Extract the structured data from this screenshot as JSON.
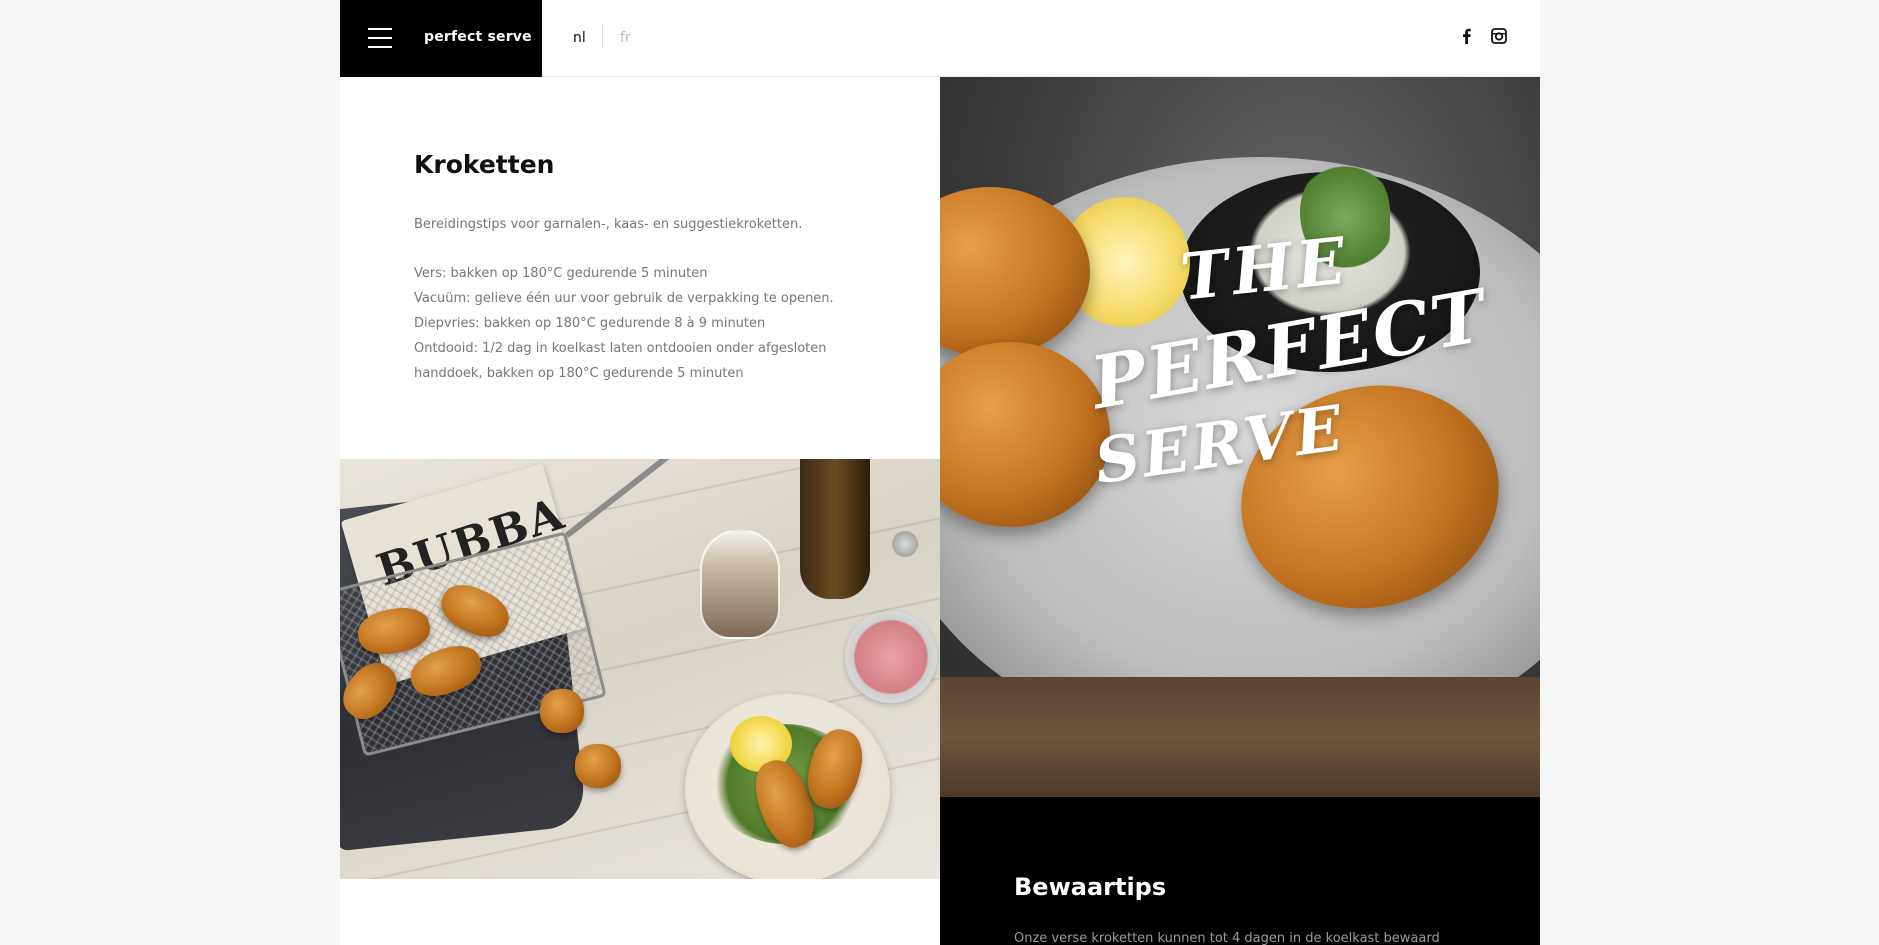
{
  "header": {
    "brand": "perfect serve",
    "languages": [
      {
        "code": "nl",
        "active": true
      },
      {
        "code": "fr",
        "active": false
      }
    ],
    "social": [
      "facebook-icon",
      "instagram-icon"
    ]
  },
  "intro": {
    "title": "Kroketten",
    "lead": "Bereidingstips voor garnalen-, kaas- en suggestiekroketten.",
    "tips": [
      "Vers: bakken op 180°C gedurende 5 minuten",
      "Vacuüm: gelieve één uur voor gebruik de verpakking te openen.",
      "Diepvries: bakken op 180°C gedurende 8 à 9 minuten",
      "Ontdooid: 1/2 dag in koelkast laten ontdooien onder afgesloten",
      "handdoek, bakken op 180°C gedurende 5 minuten"
    ]
  },
  "photo_left": {
    "bag_text": "BUBBA"
  },
  "hero": {
    "logo_lines": [
      "THE",
      "PERFECT",
      "SERVE"
    ]
  },
  "storage": {
    "title": "Bewaartips",
    "text": "Onze verse kroketten kunnen tot 4 dagen in de koelkast bewaard"
  },
  "colors": {
    "black": "#000000",
    "text_grey": "#777777",
    "background": "#f6f6f6"
  }
}
